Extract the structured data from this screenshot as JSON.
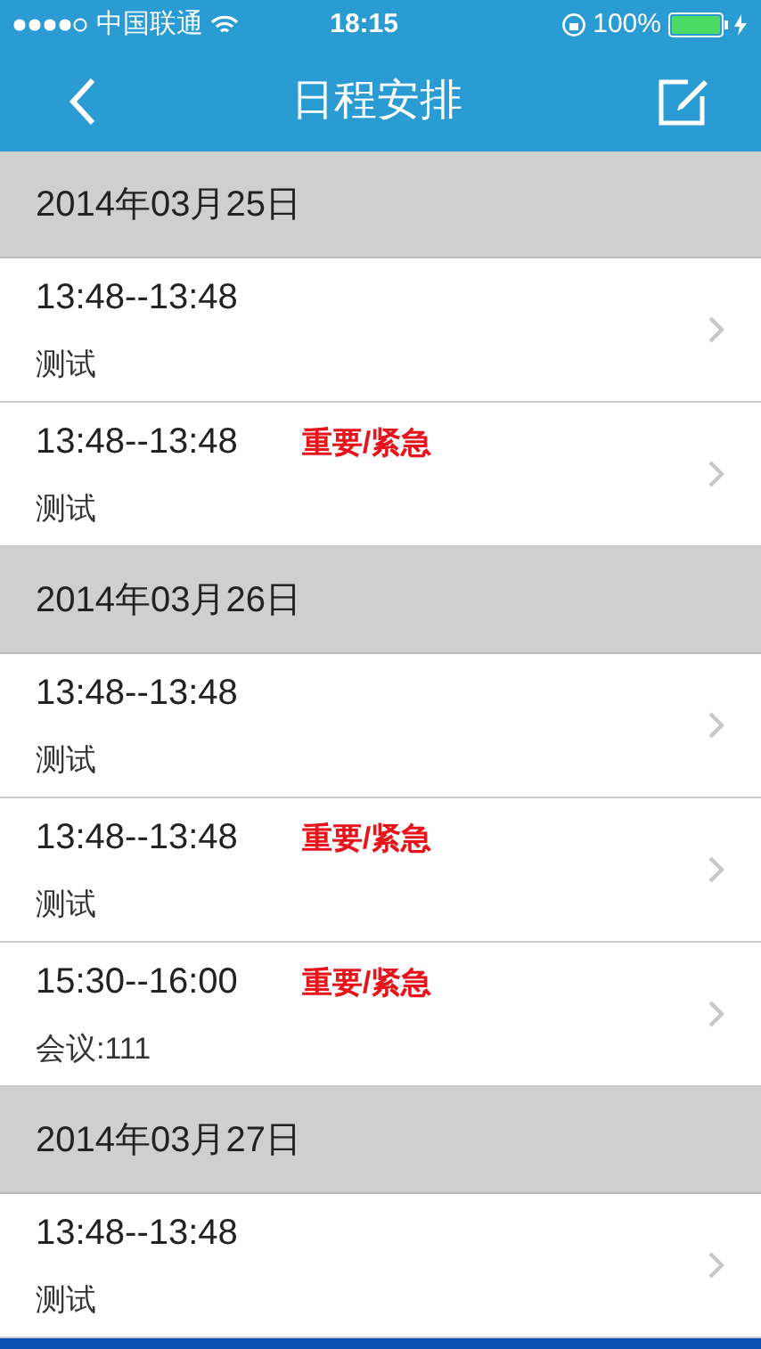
{
  "status_bar": {
    "carrier": "中国联通",
    "time": "18:15",
    "battery": "100%"
  },
  "nav": {
    "title": "日程安排"
  },
  "sections": [
    {
      "date": "2014年03月25日",
      "items": [
        {
          "time": "13:48--13:48",
          "title": "测试"
        },
        {
          "time": "13:48--13:48",
          "tag": "重要/紧急",
          "title": "测试"
        }
      ]
    },
    {
      "date": "2014年03月26日",
      "items": [
        {
          "time": "13:48--13:48",
          "title": "测试"
        },
        {
          "time": "13:48--13:48",
          "tag": "重要/紧急",
          "title": "测试"
        },
        {
          "time": "15:30--16:00",
          "tag": "重要/紧急",
          "title": "会议:111"
        }
      ]
    },
    {
      "date": "2014年03月27日",
      "items": [
        {
          "time": "13:48--13:48",
          "title": "测试"
        }
      ]
    }
  ]
}
